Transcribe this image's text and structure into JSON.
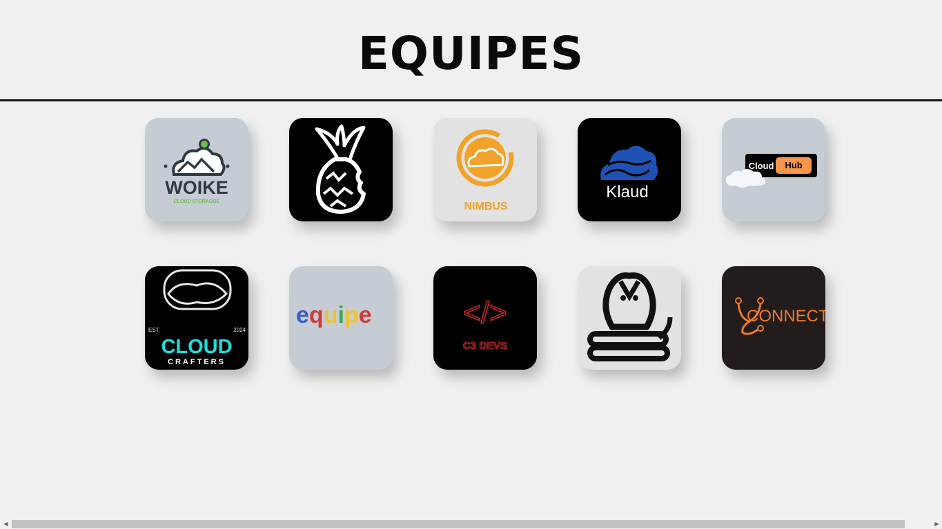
{
  "page": {
    "title": "EQUIPES"
  },
  "teams": [
    {
      "name": "Woike",
      "logo_text": "WOIKE",
      "logo_subtext": "CLOUD STORAGGE",
      "bg": "#c5ccd4",
      "icon": "cloud-mountain-icon"
    },
    {
      "name": "Pineapple",
      "bg": "#000000",
      "icon": "pineapple-icon"
    },
    {
      "name": "Nimbus",
      "logo_text": "NIMBUS",
      "bg": "#e2e2e2",
      "accent": "#f0a22a",
      "icon": "sun-cloud-icon"
    },
    {
      "name": "Klaud",
      "logo_text": "Klaud",
      "bg": "#000000",
      "accent": "#1e52b4",
      "icon": "blue-cloud-icon"
    },
    {
      "name": "Cloud Hub",
      "logo_text_left": "Cloud",
      "logo_text_right": "Hub",
      "bg": "#c5ccd4",
      "accent": "#f7964a",
      "icon": "cloud-hub-icon"
    },
    {
      "name": "Cloud Crafters",
      "logo_est": "EST.",
      "logo_year": "2024",
      "logo_text": "CLOUD",
      "logo_subtext": "CRAFTERS",
      "bg": "#000000",
      "accent": "#19e0e0",
      "icon": "outline-cloud-icon"
    },
    {
      "name": "equipe",
      "logo_letters": [
        "e",
        "q",
        "u",
        "i",
        "p",
        "e"
      ],
      "bg": "#c5ccd4",
      "icon": "equipe-wordmark-icon"
    },
    {
      "name": "C3 Devs",
      "logo_code": "</>",
      "logo_text": "C3 DEVS",
      "bg": "#000000",
      "accent": "#d12a2a",
      "icon": "code-brackets-icon"
    },
    {
      "name": "Cobra",
      "bg": "#e2e2e2",
      "icon": "cobra-icon"
    },
    {
      "name": "Connect",
      "logo_text": "CONNECT",
      "bg": "#231c1c",
      "accent": "#ee7a2a",
      "icon": "connect-node-icon"
    }
  ],
  "scrollbar": {
    "left_arrow": "◀",
    "right_arrow": "▶"
  }
}
